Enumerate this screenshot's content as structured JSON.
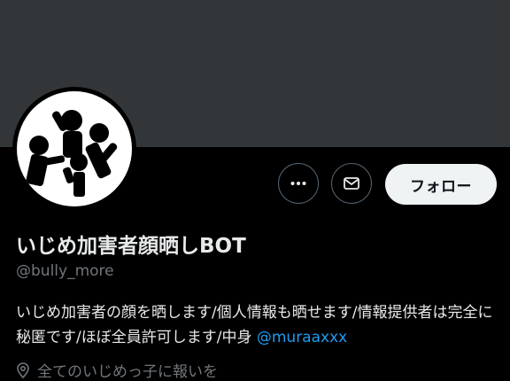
{
  "profile": {
    "display_name": "いじめ加害者顔晒しBOT",
    "handle": "@bully_more",
    "bio_text": "いじめ加害者の顔を晒します/個人情報も晒せます/情報提供者は完全に秘匿です/ほぼ全員許可します/中身 ",
    "bio_mention": "@muraaxxx",
    "location": "全てのいじめっ子に報いを"
  },
  "actions": {
    "more_icon": "more-icon",
    "mail_icon": "mail-icon",
    "follow_label": "フォロー"
  },
  "colors": {
    "banner": "#333639",
    "background": "#000000",
    "text": "#e7e9ea",
    "secondary": "#71767b",
    "link": "#1d9bf0",
    "follow_bg": "#eff3f4"
  }
}
